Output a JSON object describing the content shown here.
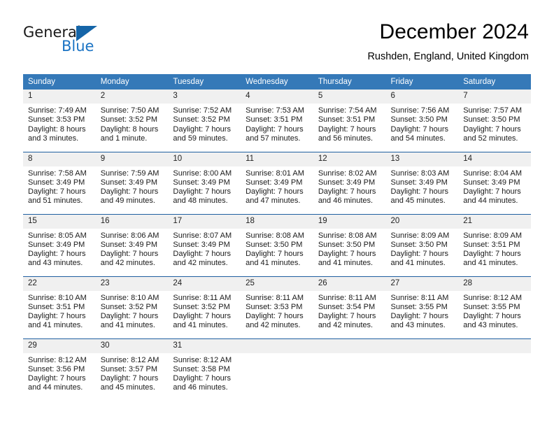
{
  "brand": {
    "name_part1": "General",
    "name_part2": "Blue",
    "logo_icon": "triangle-logo-icon",
    "accent_color": "#1c74c4"
  },
  "header": {
    "title": "December 2024",
    "location": "Rushden, England, United Kingdom"
  },
  "theme": {
    "header_row_bg": "#3579b8",
    "header_row_text": "#ffffff",
    "daynum_bg": "#f0f0f0",
    "row_divider": "#1f5fa0",
    "page_bg": "#ffffff"
  },
  "weekday_headers": [
    "Sunday",
    "Monday",
    "Tuesday",
    "Wednesday",
    "Thursday",
    "Friday",
    "Saturday"
  ],
  "weeks": [
    [
      {
        "day": "1",
        "sunrise": "Sunrise: 7:49 AM",
        "sunset": "Sunset: 3:53 PM",
        "daylight": "Daylight: 8 hours and 3 minutes."
      },
      {
        "day": "2",
        "sunrise": "Sunrise: 7:50 AM",
        "sunset": "Sunset: 3:52 PM",
        "daylight": "Daylight: 8 hours and 1 minute."
      },
      {
        "day": "3",
        "sunrise": "Sunrise: 7:52 AM",
        "sunset": "Sunset: 3:52 PM",
        "daylight": "Daylight: 7 hours and 59 minutes."
      },
      {
        "day": "4",
        "sunrise": "Sunrise: 7:53 AM",
        "sunset": "Sunset: 3:51 PM",
        "daylight": "Daylight: 7 hours and 57 minutes."
      },
      {
        "day": "5",
        "sunrise": "Sunrise: 7:54 AM",
        "sunset": "Sunset: 3:51 PM",
        "daylight": "Daylight: 7 hours and 56 minutes."
      },
      {
        "day": "6",
        "sunrise": "Sunrise: 7:56 AM",
        "sunset": "Sunset: 3:50 PM",
        "daylight": "Daylight: 7 hours and 54 minutes."
      },
      {
        "day": "7",
        "sunrise": "Sunrise: 7:57 AM",
        "sunset": "Sunset: 3:50 PM",
        "daylight": "Daylight: 7 hours and 52 minutes."
      }
    ],
    [
      {
        "day": "8",
        "sunrise": "Sunrise: 7:58 AM",
        "sunset": "Sunset: 3:49 PM",
        "daylight": "Daylight: 7 hours and 51 minutes."
      },
      {
        "day": "9",
        "sunrise": "Sunrise: 7:59 AM",
        "sunset": "Sunset: 3:49 PM",
        "daylight": "Daylight: 7 hours and 49 minutes."
      },
      {
        "day": "10",
        "sunrise": "Sunrise: 8:00 AM",
        "sunset": "Sunset: 3:49 PM",
        "daylight": "Daylight: 7 hours and 48 minutes."
      },
      {
        "day": "11",
        "sunrise": "Sunrise: 8:01 AM",
        "sunset": "Sunset: 3:49 PM",
        "daylight": "Daylight: 7 hours and 47 minutes."
      },
      {
        "day": "12",
        "sunrise": "Sunrise: 8:02 AM",
        "sunset": "Sunset: 3:49 PM",
        "daylight": "Daylight: 7 hours and 46 minutes."
      },
      {
        "day": "13",
        "sunrise": "Sunrise: 8:03 AM",
        "sunset": "Sunset: 3:49 PM",
        "daylight": "Daylight: 7 hours and 45 minutes."
      },
      {
        "day": "14",
        "sunrise": "Sunrise: 8:04 AM",
        "sunset": "Sunset: 3:49 PM",
        "daylight": "Daylight: 7 hours and 44 minutes."
      }
    ],
    [
      {
        "day": "15",
        "sunrise": "Sunrise: 8:05 AM",
        "sunset": "Sunset: 3:49 PM",
        "daylight": "Daylight: 7 hours and 43 minutes."
      },
      {
        "day": "16",
        "sunrise": "Sunrise: 8:06 AM",
        "sunset": "Sunset: 3:49 PM",
        "daylight": "Daylight: 7 hours and 42 minutes."
      },
      {
        "day": "17",
        "sunrise": "Sunrise: 8:07 AM",
        "sunset": "Sunset: 3:49 PM",
        "daylight": "Daylight: 7 hours and 42 minutes."
      },
      {
        "day": "18",
        "sunrise": "Sunrise: 8:08 AM",
        "sunset": "Sunset: 3:50 PM",
        "daylight": "Daylight: 7 hours and 41 minutes."
      },
      {
        "day": "19",
        "sunrise": "Sunrise: 8:08 AM",
        "sunset": "Sunset: 3:50 PM",
        "daylight": "Daylight: 7 hours and 41 minutes."
      },
      {
        "day": "20",
        "sunrise": "Sunrise: 8:09 AM",
        "sunset": "Sunset: 3:50 PM",
        "daylight": "Daylight: 7 hours and 41 minutes."
      },
      {
        "day": "21",
        "sunrise": "Sunrise: 8:09 AM",
        "sunset": "Sunset: 3:51 PM",
        "daylight": "Daylight: 7 hours and 41 minutes."
      }
    ],
    [
      {
        "day": "22",
        "sunrise": "Sunrise: 8:10 AM",
        "sunset": "Sunset: 3:51 PM",
        "daylight": "Daylight: 7 hours and 41 minutes."
      },
      {
        "day": "23",
        "sunrise": "Sunrise: 8:10 AM",
        "sunset": "Sunset: 3:52 PM",
        "daylight": "Daylight: 7 hours and 41 minutes."
      },
      {
        "day": "24",
        "sunrise": "Sunrise: 8:11 AM",
        "sunset": "Sunset: 3:52 PM",
        "daylight": "Daylight: 7 hours and 41 minutes."
      },
      {
        "day": "25",
        "sunrise": "Sunrise: 8:11 AM",
        "sunset": "Sunset: 3:53 PM",
        "daylight": "Daylight: 7 hours and 42 minutes."
      },
      {
        "day": "26",
        "sunrise": "Sunrise: 8:11 AM",
        "sunset": "Sunset: 3:54 PM",
        "daylight": "Daylight: 7 hours and 42 minutes."
      },
      {
        "day": "27",
        "sunrise": "Sunrise: 8:11 AM",
        "sunset": "Sunset: 3:55 PM",
        "daylight": "Daylight: 7 hours and 43 minutes."
      },
      {
        "day": "28",
        "sunrise": "Sunrise: 8:12 AM",
        "sunset": "Sunset: 3:55 PM",
        "daylight": "Daylight: 7 hours and 43 minutes."
      }
    ],
    [
      {
        "day": "29",
        "sunrise": "Sunrise: 8:12 AM",
        "sunset": "Sunset: 3:56 PM",
        "daylight": "Daylight: 7 hours and 44 minutes."
      },
      {
        "day": "30",
        "sunrise": "Sunrise: 8:12 AM",
        "sunset": "Sunset: 3:57 PM",
        "daylight": "Daylight: 7 hours and 45 minutes."
      },
      {
        "day": "31",
        "sunrise": "Sunrise: 8:12 AM",
        "sunset": "Sunset: 3:58 PM",
        "daylight": "Daylight: 7 hours and 46 minutes."
      },
      {
        "day": "",
        "sunrise": "",
        "sunset": "",
        "daylight": ""
      },
      {
        "day": "",
        "sunrise": "",
        "sunset": "",
        "daylight": ""
      },
      {
        "day": "",
        "sunrise": "",
        "sunset": "",
        "daylight": ""
      },
      {
        "day": "",
        "sunrise": "",
        "sunset": "",
        "daylight": ""
      }
    ]
  ]
}
